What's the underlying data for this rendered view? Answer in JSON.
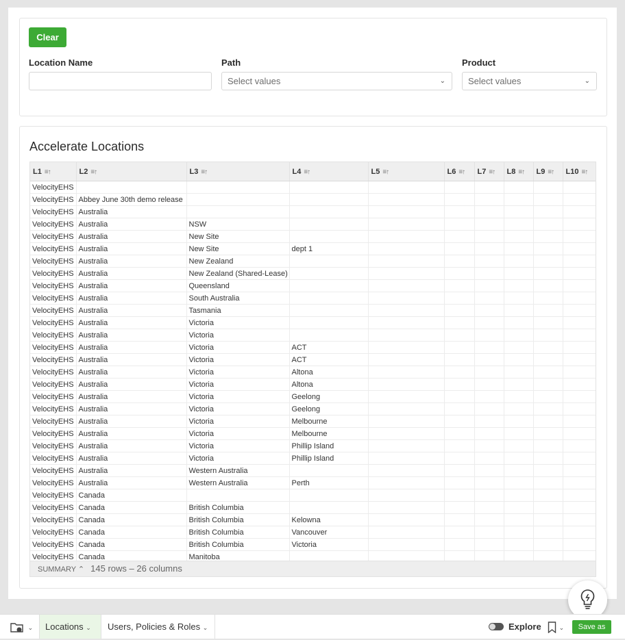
{
  "filters": {
    "clear_label": "Clear",
    "location_name_label": "Location Name",
    "location_name_value": "",
    "path_label": "Path",
    "path_placeholder": "Select values",
    "product_label": "Product",
    "product_placeholder": "Select values"
  },
  "table": {
    "title": "Accelerate Locations",
    "columns": [
      "L1",
      "L2",
      "L3",
      "L4",
      "L5",
      "L6",
      "L7",
      "L8",
      "L9",
      "L10"
    ],
    "rows": [
      [
        "VelocityEHS",
        "",
        "",
        ""
      ],
      [
        "VelocityEHS",
        "Abbey June 30th demo release",
        "",
        ""
      ],
      [
        "VelocityEHS",
        "Australia",
        "",
        ""
      ],
      [
        "VelocityEHS",
        "Australia",
        "NSW",
        ""
      ],
      [
        "VelocityEHS",
        "Australia",
        "New Site",
        ""
      ],
      [
        "VelocityEHS",
        "Australia",
        "New Site",
        "dept 1"
      ],
      [
        "VelocityEHS",
        "Australia",
        "New Zealand",
        ""
      ],
      [
        "VelocityEHS",
        "Australia",
        "New Zealand (Shared-Lease)",
        ""
      ],
      [
        "VelocityEHS",
        "Australia",
        "Queensland",
        ""
      ],
      [
        "VelocityEHS",
        "Australia",
        "South Australia",
        ""
      ],
      [
        "VelocityEHS",
        "Australia",
        "Tasmania",
        ""
      ],
      [
        "VelocityEHS",
        "Australia",
        "Victoria",
        ""
      ],
      [
        "VelocityEHS",
        "Australia",
        "Victoria",
        ""
      ],
      [
        "VelocityEHS",
        "Australia",
        "Victoria",
        "ACT"
      ],
      [
        "VelocityEHS",
        "Australia",
        "Victoria",
        "ACT"
      ],
      [
        "VelocityEHS",
        "Australia",
        "Victoria",
        "Altona"
      ],
      [
        "VelocityEHS",
        "Australia",
        "Victoria",
        "Altona"
      ],
      [
        "VelocityEHS",
        "Australia",
        "Victoria",
        "Geelong"
      ],
      [
        "VelocityEHS",
        "Australia",
        "Victoria",
        "Geelong"
      ],
      [
        "VelocityEHS",
        "Australia",
        "Victoria",
        "Melbourne"
      ],
      [
        "VelocityEHS",
        "Australia",
        "Victoria",
        "Melbourne"
      ],
      [
        "VelocityEHS",
        "Australia",
        "Victoria",
        "Phillip Island"
      ],
      [
        "VelocityEHS",
        "Australia",
        "Victoria",
        "Phillip Island"
      ],
      [
        "VelocityEHS",
        "Australia",
        "Western Australia",
        ""
      ],
      [
        "VelocityEHS",
        "Australia",
        "Western Australia",
        "Perth"
      ],
      [
        "VelocityEHS",
        "Canada",
        "",
        ""
      ],
      [
        "VelocityEHS",
        "Canada",
        "British Columbia",
        ""
      ],
      [
        "VelocityEHS",
        "Canada",
        "British Columbia",
        "Kelowna"
      ],
      [
        "VelocityEHS",
        "Canada",
        "British Columbia",
        "Vancouver"
      ],
      [
        "VelocityEHS",
        "Canada",
        "British Columbia",
        "Victoria"
      ],
      [
        "VelocityEHS",
        "Canada",
        "Manitoba",
        ""
      ]
    ],
    "summary_label": "SUMMARY",
    "summary_count": "145 rows – 26 columns"
  },
  "bottom_bar": {
    "tab_locations": "Locations",
    "tab_users": "Users, Policies & Roles",
    "explore_label": "Explore",
    "save_as_label": "Save as"
  },
  "icons": {
    "folder": "folder-icon",
    "sort": "sort-icon",
    "chevron": "chevron-down-icon",
    "bookmark": "bookmark-icon",
    "lightbulb": "lightbulb-icon"
  },
  "colors": {
    "accent_green": "#3daa35",
    "active_tab_bg": "#eaf6e6"
  }
}
